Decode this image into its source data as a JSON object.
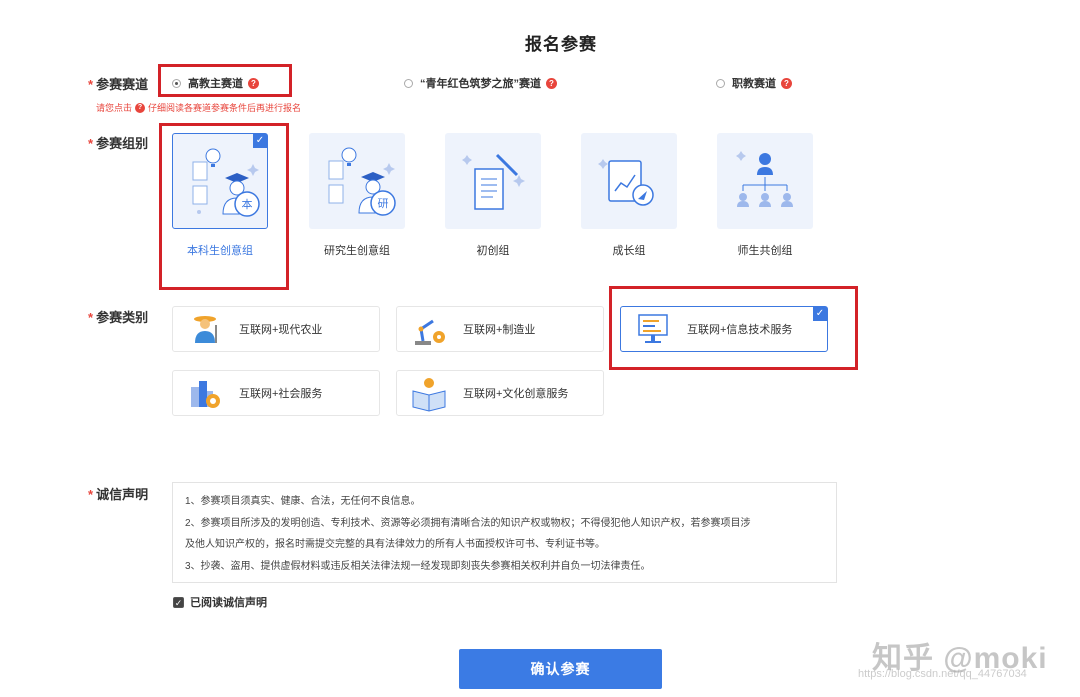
{
  "page": {
    "title": "报名参赛"
  },
  "track": {
    "label": "参赛赛道",
    "options": [
      {
        "label": "高教主赛道",
        "checked": true
      },
      {
        "label": "“青年红色筑梦之旅”赛道",
        "checked": false
      },
      {
        "label": "职教赛道",
        "checked": false
      }
    ],
    "help_glyph": "?",
    "hint_before": "请您点击",
    "hint_after": "仔细阅读各赛道参赛条件后再进行报名"
  },
  "group": {
    "label": "参赛组别",
    "options": [
      {
        "label": "本科生创意组",
        "badge": "本",
        "selected": true,
        "icon": "student-undergrad-icon"
      },
      {
        "label": "研究生创意组",
        "badge": "研",
        "selected": false,
        "icon": "student-graduate-icon"
      },
      {
        "label": "初创组",
        "selected": false,
        "icon": "document-wand-icon"
      },
      {
        "label": "成长组",
        "selected": false,
        "icon": "growth-chart-icon"
      },
      {
        "label": "师生共创组",
        "selected": false,
        "icon": "team-tree-icon"
      }
    ]
  },
  "category": {
    "label": "参赛类别",
    "options": [
      {
        "label": "互联网+现代农业",
        "selected": false,
        "icon": "farmer-icon"
      },
      {
        "label": "互联网+制造业",
        "selected": false,
        "icon": "robot-arm-icon"
      },
      {
        "label": "互联网+信息技术服务",
        "selected": true,
        "icon": "monitor-icon"
      },
      {
        "label": "互联网+社会服务",
        "selected": false,
        "icon": "city-service-icon"
      },
      {
        "label": "互联网+文化创意服务",
        "selected": false,
        "icon": "book-bulb-icon"
      }
    ]
  },
  "declaration": {
    "label": "诚信声明",
    "lines": [
      "1、参赛项目须真实、健康、合法，无任何不良信息。",
      "2、参赛项目所涉及的发明创造、专利技术、资源等必须拥有清晰合法的知识产权或物权；不得侵犯他人知识产权，若参赛项目涉",
      "及他人知识产权的，报名时需提交完整的具有法律效力的所有人书面授权许可书、专利证书等。",
      "3、抄袭、盗用、提供虚假材料或违反相关法律法规一经发现即刻丧失参赛相关权利并自负一切法律责任。"
    ],
    "agree_label": "已阅读诚信声明",
    "agree_checked": true
  },
  "submit_label": "确认参赛",
  "watermark": {
    "text": "知乎 @moki",
    "url": "https://blog.csdn.net/qq_44767034"
  },
  "colors": {
    "accent": "#3b7be4",
    "required": "#e8453c",
    "highlight_box": "#d32228"
  }
}
